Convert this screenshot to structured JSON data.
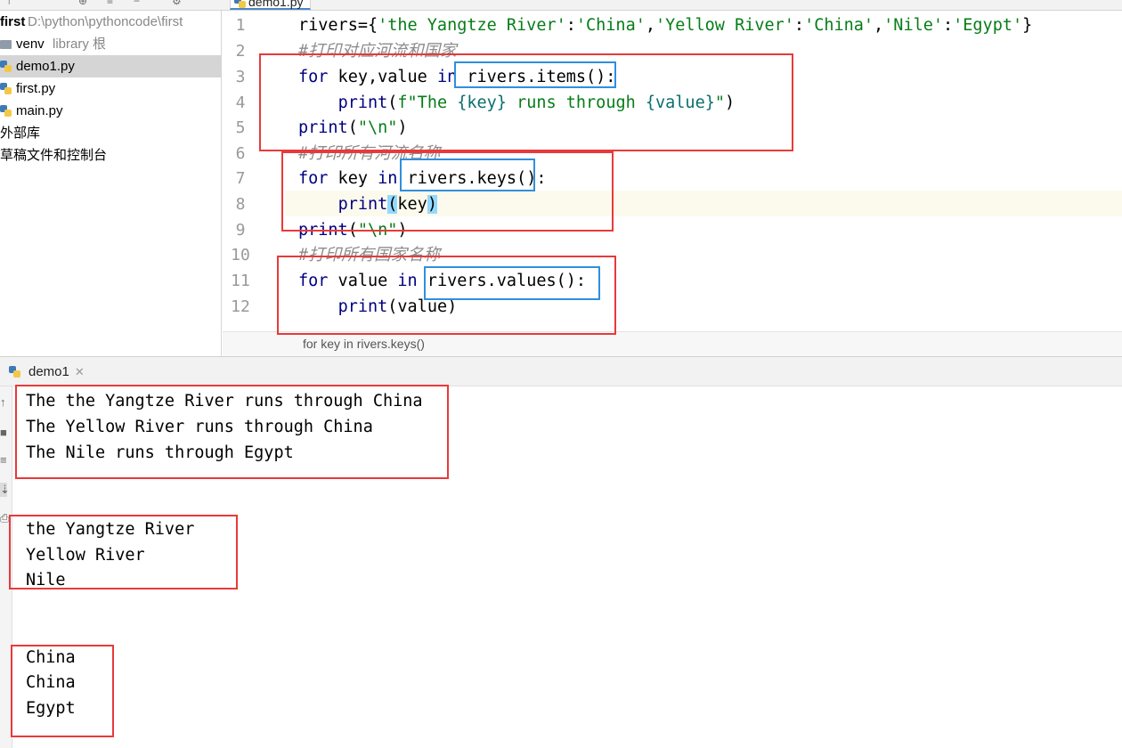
{
  "window": {
    "editor_tab": "demo1.py"
  },
  "project_tree": {
    "root": {
      "name": "first",
      "path": "D:\\python\\pythoncode\\first"
    },
    "items": [
      {
        "label": "venv",
        "hint": "library 根",
        "icon": "folder-icon"
      },
      {
        "label": "demo1.py",
        "icon": "python-file-icon",
        "selected": true
      },
      {
        "label": "first.py",
        "icon": "python-file-icon"
      },
      {
        "label": "main.py",
        "icon": "python-file-icon"
      }
    ],
    "external_libraries": "外部库",
    "scratches": "草稿文件和控制台"
  },
  "editor": {
    "line_numbers": [
      "1",
      "2",
      "3",
      "4",
      "5",
      "6",
      "7",
      "8",
      "9",
      "10",
      "11",
      "12"
    ],
    "lines": {
      "l1_a": "rivers={",
      "l1_s1": "'the Yangtze River'",
      "l1_c1": ":",
      "l1_s2": "'China'",
      "l1_c2": ",",
      "l1_s3": "'Yellow River'",
      "l1_c3": ":",
      "l1_s4": "'China'",
      "l1_c4": ",",
      "l1_s5": "'Nile'",
      "l1_c5": ":",
      "l1_s6": "'Egypt'",
      "l1_e": "}",
      "l2": "#打印对应河流和国家",
      "l3_kw1": "for",
      "l3_a": " key,value ",
      "l3_kw2": "in",
      "l3_b": " rivers.items():",
      "l4_indent": "    ",
      "l4_fn": "print",
      "l4_a": "(",
      "l4_f": "f\"The ",
      "l4_b1": "{key}",
      "l4_m": " runs through ",
      "l4_b2": "{value}",
      "l4_q": "\"",
      "l4_e": ")",
      "l5_fn": "print",
      "l5_a": "(",
      "l5_s": "\"\\n\"",
      "l5_e": ")",
      "l6": "#打印所有河流名称",
      "l7_kw1": "for",
      "l7_a": " key ",
      "l7_kw2": "in",
      "l7_b": " rivers.keys():",
      "l8_indent": "    ",
      "l8_fn": "print",
      "l8_p1": "(",
      "l8_a": "key",
      "l8_p2": ")",
      "l9_fn": "print",
      "l9_a": "(",
      "l9_s": "\"\\n\"",
      "l9_e": ")",
      "l10": "#打印所有国家名称",
      "l11_kw1": "for",
      "l11_a": " value ",
      "l11_kw2": "in",
      "l11_b": " rivers.values():",
      "l12_indent": "    ",
      "l12_fn": "print",
      "l12_a": "(value)"
    },
    "breadcrumb": "for key in rivers.keys()"
  },
  "run_panel": {
    "tab_label": "demo1",
    "output": [
      "The the Yangtze River runs through China",
      "The Yellow River runs through China",
      "The Nile runs through Egypt",
      "the Yangtze River",
      "Yellow River",
      "Nile",
      "China",
      "China",
      "Egypt"
    ]
  },
  "colors": {
    "annotation_red": "#e83a3a",
    "annotation_blue": "#2f8fde",
    "keyword": "#000080",
    "string": "#067d17"
  }
}
